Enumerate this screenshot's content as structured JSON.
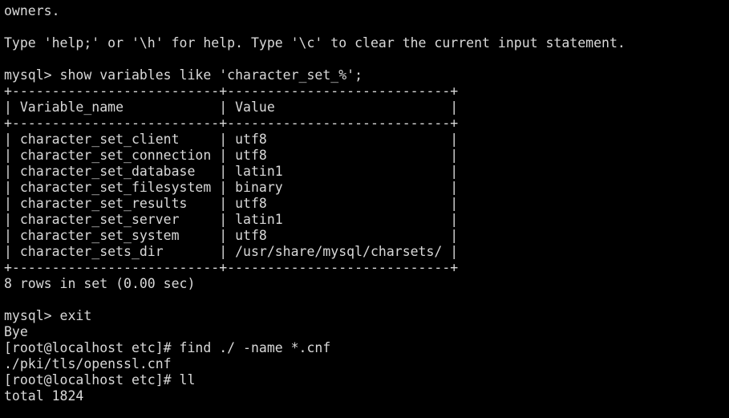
{
  "terminal": {
    "background": "#000000",
    "foreground": "#d9d9d9",
    "lines": [
      "owners.",
      "",
      "Type 'help;' or '\\h' for help. Type '\\c' to clear the current input statement.",
      "",
      "mysql> show variables like 'character_set_%';",
      "+--------------------------+----------------------------+",
      "| Variable_name            | Value                      |",
      "+--------------------------+----------------------------+",
      "| character_set_client     | utf8                       |",
      "| character_set_connection | utf8                       |",
      "| character_set_database   | latin1                     |",
      "| character_set_filesystem | binary                     |",
      "| character_set_results    | utf8                       |",
      "| character_set_server     | latin1                     |",
      "| character_set_system     | utf8                       |",
      "| character_sets_dir       | /usr/share/mysql/charsets/ |",
      "+--------------------------+----------------------------+",
      "8 rows in set (0.00 sec)",
      "",
      "mysql> exit",
      "Bye",
      "[root@localhost etc]# find ./ -name *.cnf",
      "./pki/tls/openssl.cnf",
      "[root@localhost etc]# ll",
      "total 1824"
    ]
  }
}
